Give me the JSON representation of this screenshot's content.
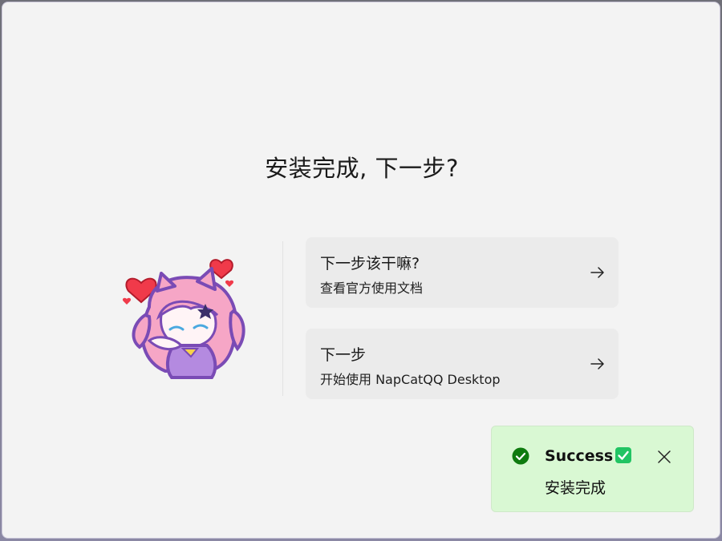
{
  "heading": "安装完成, 下一步?",
  "cards": [
    {
      "title": "下一步该干嘛?",
      "subtitle": "查看官方使用文档",
      "icon": "arrow-right-icon"
    },
    {
      "title": "下一步",
      "subtitle": "开始使用 NapCatQQ Desktop",
      "icon": "arrow-right-icon"
    }
  ],
  "toast": {
    "title": "Success",
    "message": "安装完成",
    "status_icon": "check-circle-icon",
    "title_emoji": "check-mark-button-icon",
    "close_icon": "close-icon",
    "background_color": "#d9f8d3",
    "accent_color": "#0f7b0f"
  },
  "mascot": "mascot-illustration",
  "colors": {
    "window_bg": "#f3f3f3",
    "card_bg": "#ebebeb"
  }
}
